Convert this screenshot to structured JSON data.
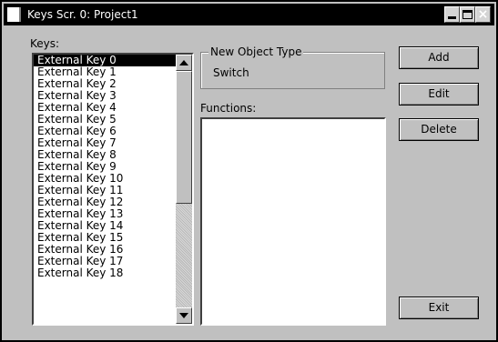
{
  "window": {
    "title": "Keys Scr. 0: Project1"
  },
  "keys": {
    "label": "Keys:",
    "items": [
      "External Key 0",
      "External Key 1",
      "External Key 2",
      "External Key 3",
      "External Key 4",
      "External Key 5",
      "External Key 6",
      "External Key 7",
      "External Key 8",
      "External Key 9",
      "External Key 10",
      "External Key 11",
      "External Key 12",
      "External Key 13",
      "External Key 14",
      "External Key 15",
      "External Key 16",
      "External Key 17",
      "External Key 18"
    ],
    "selected_index": 0
  },
  "object_type": {
    "legend": "New Object Type",
    "value": "Switch"
  },
  "functions": {
    "label": "Functions:"
  },
  "buttons": {
    "add": "Add",
    "edit": "Edit",
    "delete": "Delete",
    "exit": "Exit"
  },
  "icons": {
    "app": "window-icon",
    "minimize": "minimize-icon",
    "maximize": "maximize-icon",
    "close": "close-icon",
    "scroll_up": "arrow-up-icon",
    "scroll_down": "arrow-down-icon"
  },
  "colors": {
    "face": "#c0c0c0",
    "titlebar": "#000000",
    "selection": "#000000"
  }
}
